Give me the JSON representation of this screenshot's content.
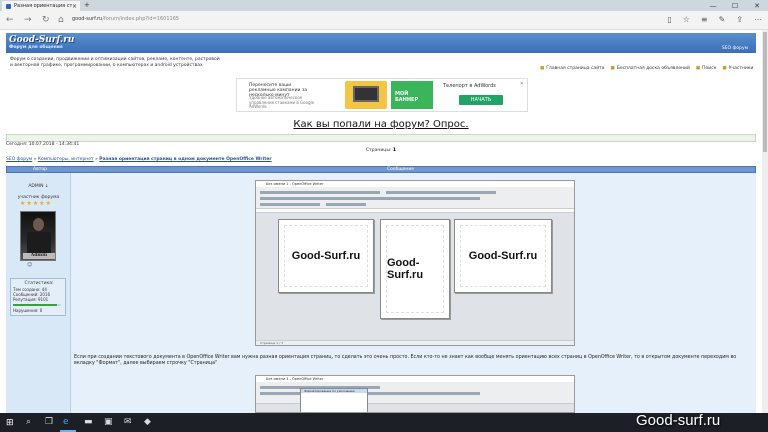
{
  "browser": {
    "tab_title": "Разная ориентация стр",
    "url_domain": "good-surf.ru",
    "url_path": "/forum/index.php?id=1601165",
    "minimize": "—",
    "maximize": "☐",
    "close": "✕"
  },
  "site": {
    "logo": "Good-Surf.ru",
    "logo_subtitle": "Форум для общения",
    "header_link": "SEO форум",
    "description": "Форум о создании, продвижении и оптимизации сайтов, рекламе, контенте, растровой и векторной графике, программировании, о компьютерах и android устройствах",
    "top_links": [
      "Главная страница сайта",
      "Бесплатная доска объявлений",
      "Поиск",
      "Участники"
    ]
  },
  "ad": {
    "text1": "Переносите ваши рекламные кампании за несколько минут",
    "text2": "Удобное автоматическое управление ставками в Google AdWords",
    "badge": "МОЙ БАННЕР",
    "text3": "Телепорт в AdWords",
    "button": "НАЧАТЬ",
    "close": "✕"
  },
  "topic": {
    "poll_link": "Как вы попали на форум? Опрос.",
    "today": "Сегодня: 10.07.2018 - 14:34:41",
    "pages_label": "Страницы:",
    "pages_value": "1",
    "crumbs": [
      "SEO форум",
      "Компьютеры, интернет",
      "Разная ориентация страниц в одном документе OpenOffice Writer"
    ]
  },
  "table": {
    "col_author": "Автор",
    "col_message": "Сообщение"
  },
  "author": {
    "name": "ADMIN",
    "role": "участник форума",
    "stars": "★★★★★",
    "avatar_label": "Admin",
    "stats_title": "Статистика:",
    "stats": [
      "Тем создано: 44",
      "Сообщений: 2016",
      "Репутация: 9101",
      "Нарушения: 0"
    ],
    "reputation_fraction": 0.92
  },
  "post": {
    "shot_title": "Без имени 1 - OpenOffice Writer",
    "page_text": "Good-Surf.ru",
    "shot_status": "Страница 1 / 3",
    "paragraph": "Если при создании текстового документа в OpenOffice Writer вам нужна разная ориентация страниц, то сделать это очень просто. Если кто-то не знает как вообще менять ориентацию всех страниц в OpenOffice Writer, то в открытом документе переходим во вкладку \"Формат\", далее выбираем строчку \"Страница\"",
    "shot2_title": "Без имени 1 - OpenOffice Writer",
    "menu_item": "Форматирование по умолчанию"
  },
  "taskbar": {
    "watermark": "Good-surf.ru"
  }
}
